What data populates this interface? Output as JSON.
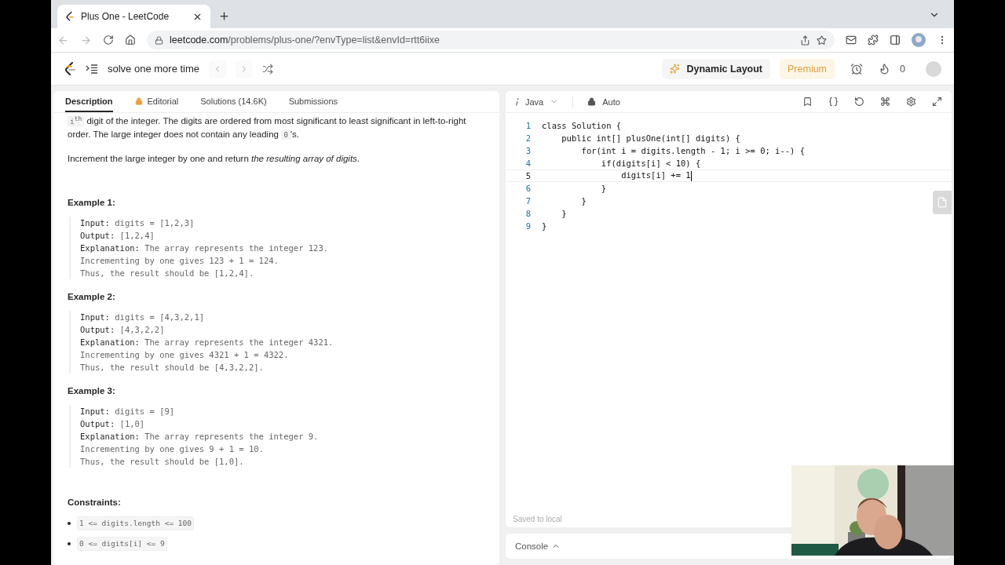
{
  "browser": {
    "tab": {
      "title": "Plus One - LeetCode"
    },
    "address": {
      "host": "leetcode.com",
      "path": "/problems/plus-one/?envType=list&envId=rtt6iixe"
    }
  },
  "nav": {
    "list_title": "solve one more time",
    "dynamic_layout": "Dynamic Layout",
    "premium": "Premium",
    "streak": "0"
  },
  "left_tabs": [
    {
      "label": "Description",
      "selected": true,
      "locked": false
    },
    {
      "label": "Editorial",
      "selected": false,
      "locked": true
    },
    {
      "label": "Solutions (14.6K)",
      "selected": false,
      "locked": false
    },
    {
      "label": "Submissions",
      "selected": false,
      "locked": false
    }
  ],
  "description": {
    "paragraphs": [
      [
        {
          "kind": "code",
          "text": "i$^{th}$"
        },
        {
          "kind": "text",
          "text": " digit of the integer. The digits are ordered from most significant to least significant in left-to-right order. The large integer does not contain any leading "
        },
        {
          "kind": "code",
          "text": "0"
        },
        {
          "kind": "text",
          "text": "'s."
        }
      ],
      [
        {
          "kind": "text",
          "text": "Increment the large integer by one and return *the resulting array of digits*."
        }
      ]
    ],
    "examples": [
      {
        "title": "Example 1:",
        "lines": [
          "**Input:** digits = [1,2,3]",
          "**Output:** [1,2,4]",
          "**Explanation:** The array represents the integer 123.",
          "Incrementing by one gives 123 + 1 = 124.",
          "Thus, the result should be [1,2,4]."
        ]
      },
      {
        "title": "Example 2:",
        "lines": [
          "**Input:** digits = [4,3,2,1]",
          "**Output:** [4,3,2,2]",
          "**Explanation:** The array represents the integer 4321.",
          "Incrementing by one gives 4321 + 1 = 4322.",
          "Thus, the result should be [4,3,2,2]."
        ]
      },
      {
        "title": "Example 3:",
        "lines": [
          "**Input:** digits = [9]",
          "**Output:** [1,0]",
          "**Explanation:** The array represents the integer 9.",
          "Incrementing by one gives 9 + 1 = 10.",
          "Thus, the result should be [1,0]."
        ]
      }
    ],
    "constraints_title": "Constraints:",
    "constraints": [
      "1 <= digits.length <= 100",
      "0 <= digits[i] <= 9"
    ]
  },
  "editor": {
    "language": "Java",
    "mode": "Auto",
    "saved": "Saved to local",
    "lines": [
      {
        "number": "1",
        "selected": false,
        "text": "class Solution {"
      },
      {
        "number": "2",
        "selected": false,
        "text": "    public int[] plusOne(int[] digits) {"
      },
      {
        "number": "3",
        "selected": false,
        "text": "        for(int i = digits.length - 1; i >= 0; i--) {"
      },
      {
        "number": "4",
        "selected": false,
        "text": "            if(digits[i] < 10) {"
      },
      {
        "number": "5",
        "selected": true,
        "text": "                digits[i] += 1"
      },
      {
        "number": "6",
        "selected": false,
        "text": "            }"
      },
      {
        "number": "7",
        "selected": false,
        "text": "        }"
      },
      {
        "number": "8",
        "selected": false,
        "text": "    }"
      },
      {
        "number": "9",
        "selected": false,
        "text": "}"
      }
    ]
  },
  "console": {
    "label": "Console"
  }
}
